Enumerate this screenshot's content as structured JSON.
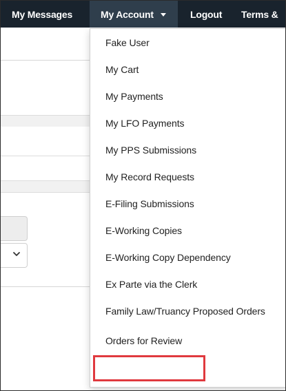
{
  "navbar": {
    "items": [
      {
        "label": "My Messages"
      },
      {
        "label": "My Account"
      },
      {
        "label": "Logout"
      },
      {
        "label": "Terms &"
      }
    ]
  },
  "dropdown": {
    "items": [
      {
        "label": "Fake User"
      },
      {
        "label": "My Cart"
      },
      {
        "label": "My Payments"
      },
      {
        "label": "My LFO Payments"
      },
      {
        "label": "My PPS Submissions"
      },
      {
        "label": "My Record Requests"
      },
      {
        "label": "E-Filing Submissions"
      },
      {
        "label": "E-Working Copies"
      },
      {
        "label": "E-Working Copy Dependency"
      },
      {
        "label": "Ex Parte via the Clerk"
      },
      {
        "label": "Family Law/Truancy Proposed Orders"
      },
      {
        "label": "Orders for Review"
      }
    ]
  },
  "colors": {
    "navbar_bg": "#19232d",
    "active_nav_bg": "#2f3e4c",
    "highlight_border": "#e0393e"
  },
  "icons": {
    "account_caret": "caret-down-icon",
    "select_chevron": "chevron-down-icon"
  }
}
